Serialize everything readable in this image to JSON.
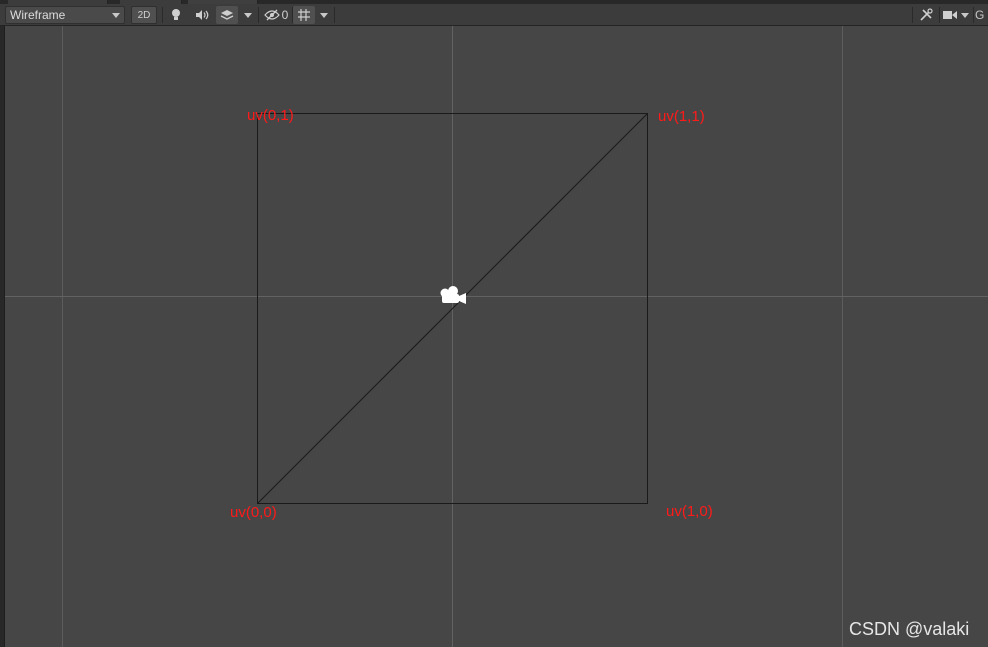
{
  "toolbar": {
    "draw_mode": "Wireframe",
    "mode_2d_label": "2D",
    "hidden_count": "0",
    "edge_label": "G"
  },
  "scene": {
    "labels": {
      "top_left": "uv(0,1)",
      "top_right": "uv(1,1)",
      "bottom_left": "uv(0,0)",
      "bottom_right": "uv(1,0)"
    },
    "gizmo": "camera-icon"
  },
  "watermark": "CSDN @valaki",
  "colors": {
    "viewport_bg": "#464646",
    "toolbar_bg": "#3c3c3c",
    "uv_label": "#ff1a1a",
    "grid_line": "#5c5c5c",
    "mesh_line": "#1a1a1a"
  }
}
